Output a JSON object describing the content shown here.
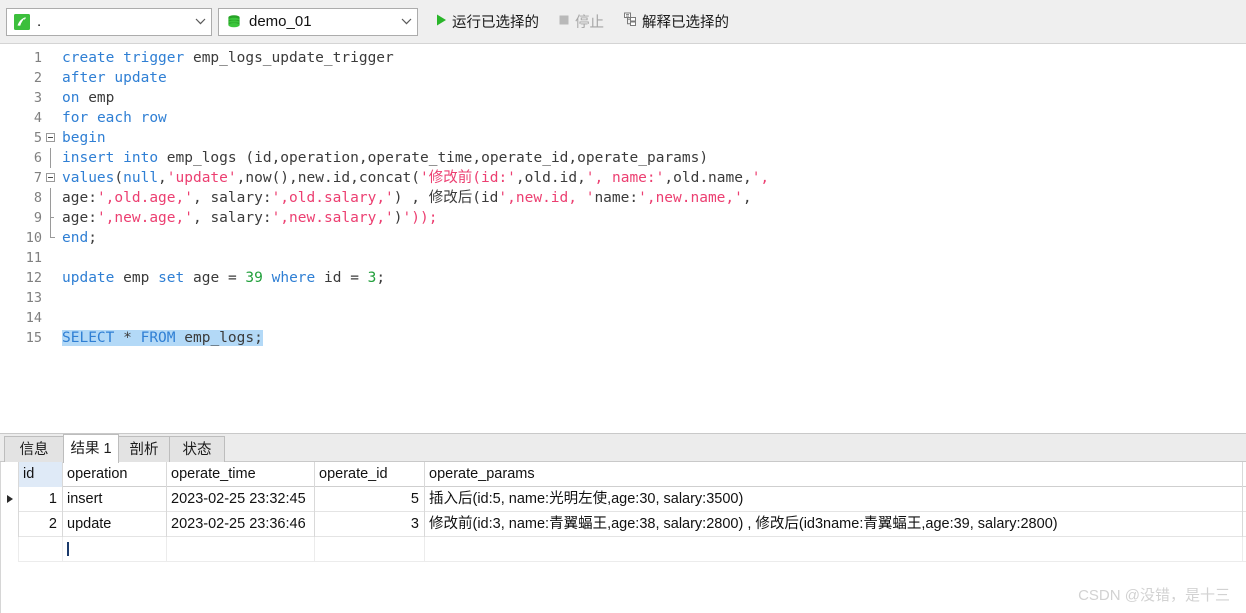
{
  "toolbar": {
    "connection": {
      "value": ".",
      "icon": "navicat-connection-icon"
    },
    "database": {
      "value": "demo_01",
      "icon": "database-icon"
    },
    "run_selected": {
      "label": "运行已选择的",
      "icon": "play-icon"
    },
    "stop": {
      "label": "停止",
      "icon": "stop-icon",
      "enabled": false
    },
    "explain_selected": {
      "label": "解释已选择的",
      "icon": "explain-plan-icon"
    }
  },
  "editor": {
    "selection_line": 15,
    "lines": [
      {
        "n": 1,
        "text": "create trigger emp_logs_update_trigger"
      },
      {
        "n": 2,
        "text": "after update"
      },
      {
        "n": 3,
        "text": "on emp"
      },
      {
        "n": 4,
        "text": "for each row"
      },
      {
        "n": 5,
        "text": "begin"
      },
      {
        "n": 6,
        "text": "insert into emp_logs (id,operation,operate_time,operate_id,operate_params)"
      },
      {
        "n": 7,
        "text": "values(null,'update',now(),new.id,concat('修改前(id:',old.id,', name:',old.name,',"
      },
      {
        "n": 8,
        "text": "age:',old.age,', salary:',old.salary,') , 修改后(id',new.id, 'name:',new.name,',"
      },
      {
        "n": 9,
        "text": "age:',new.age,', salary:',new.salary,')'));"
      },
      {
        "n": 10,
        "text": "end;"
      },
      {
        "n": 11,
        "text": ""
      },
      {
        "n": 12,
        "text": "update emp set age = 39 where id = 3;"
      },
      {
        "n": 13,
        "text": ""
      },
      {
        "n": 14,
        "text": ""
      },
      {
        "n": 15,
        "text": "SELECT * FROM emp_logs;"
      }
    ]
  },
  "results": {
    "tabs": [
      {
        "label": "信息",
        "active": false
      },
      {
        "label": "结果 1",
        "active": true
      },
      {
        "label": "剖析",
        "active": false
      },
      {
        "label": "状态",
        "active": false
      }
    ],
    "columns": [
      "id",
      "operation",
      "operate_time",
      "operate_id",
      "operate_params"
    ],
    "rows": [
      {
        "id": "1",
        "operation": "insert",
        "operate_time": "2023-02-25 23:32:45",
        "operate_id": "5",
        "operate_params": "插入后(id:5, name:光明左使,age:30, salary:3500)"
      },
      {
        "id": "2",
        "operation": "update",
        "operate_time": "2023-02-25 23:36:46",
        "operate_id": "3",
        "operate_params": "修改前(id:3, name:青翼蝠王,age:38, salary:2800) , 修改后(id3name:青翼蝠王,age:39, salary:2800)"
      }
    ]
  },
  "watermark": {
    "text": "CSDN @没错，是十三"
  },
  "colors": {
    "keyword": "#2f7fd4",
    "string": "#ec3f71",
    "number": "#22a03c",
    "identifier": "#3b3b3b",
    "selection": "#b3d9f7",
    "toolbar_bg": "#efefef",
    "tab_active_bg": "#ffffff",
    "header_highlight": "#dfeaf7"
  }
}
